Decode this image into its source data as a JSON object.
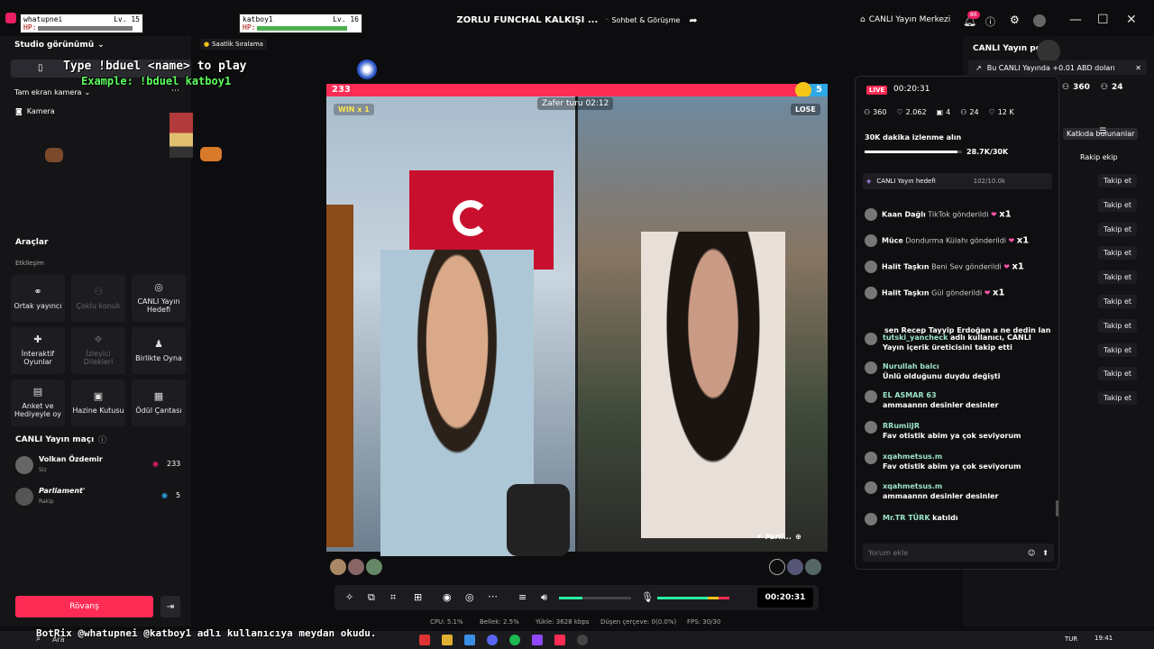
{
  "titlebar": {
    "stream_title": "ZORLU FUNCHAL KALKIŞI ...",
    "category": "Sohbet & Görüşme",
    "center_label": "CANLI Yayın Merkezi",
    "notif_count": "86"
  },
  "overlay": {
    "p1_name": "whatupnei",
    "p1_level": "Lv. 15",
    "p1_hp": "HP:",
    "p2_name": "katboy1",
    "p2_level": "Lv. 16",
    "p2_hp": "HP:",
    "cmd_line1": "Type !bduel <name> to play",
    "cmd_line2": "Example: !bduel katboy1",
    "botrix": "BotRix @whatupnei @katboy1 adlı kullanıcıya meydan okudu.",
    "hourly": "Saatlik Sıralama"
  },
  "sidebar": {
    "studio": "Studio görünümü",
    "screen": "Tam ekran kamera",
    "camera": "Kamera",
    "tools_title": "Araçlar",
    "interaction": "Etkileşim",
    "tiles": [
      {
        "label": "Ortak yayıncı",
        "icon": "link-icon",
        "dim": false
      },
      {
        "label": "Çoklu konuk",
        "icon": "users-icon",
        "dim": true
      },
      {
        "label": "CANLI Yayın Hedefi",
        "icon": "target-icon",
        "dim": false
      },
      {
        "label": "İnteraktif Oyunlar",
        "icon": "gamepad-icon",
        "dim": false
      },
      {
        "label": "İzleyici Dilekleri",
        "icon": "gift-icon",
        "dim": true
      },
      {
        "label": "Birlikte Oyna",
        "icon": "player-icon",
        "dim": false
      },
      {
        "label": "Anket ve Hediyeyle oy",
        "icon": "poll-icon",
        "dim": false
      },
      {
        "label": "Hazine Kutusu",
        "icon": "chest-icon",
        "dim": false
      },
      {
        "label": "Ödül Çantası",
        "icon": "bag-icon",
        "dim": false
      }
    ],
    "match_title": "CANLI Yayın maçı",
    "p1": {
      "name": "Volkan Özdemir",
      "role": "Siz",
      "score": "233"
    },
    "p2": {
      "name": "Parliament'",
      "role": "Rakip",
      "score": "5"
    },
    "rematch": "Rövanş"
  },
  "battle": {
    "score_left": "233",
    "score_right": "5",
    "win": "WIN x 1",
    "lose": "LOSE",
    "timer": "Zafer turu 02:12",
    "opponent_tag": "Parli..."
  },
  "controls": {
    "time": "00:20:31"
  },
  "stats": {
    "cpu": "CPU: 5.1%",
    "mem": "Bellek: 2.5%",
    "upload": "Yükle: 3628 kbps",
    "drop": "Düşen çerçeve: 0(0.0%)",
    "fps": "FPS: 30/30"
  },
  "chat": {
    "live": "LIVE",
    "time": "00:20:31",
    "viewers": "360",
    "likes": "2.062",
    "gifts": "4",
    "people": "24",
    "hearts": "12 K",
    "goal_title": "30K dakika izlenme alın",
    "goal_progress": "28.7K/30K",
    "goal_pct": 0.957,
    "goal_row": "CANLI Yayın hedefi",
    "goal_row_val": "102/10.0k",
    "gifts_rows": [
      {
        "user": "Kaan Dağlı",
        "text": "TikTok gönderildi",
        "x": "x1"
      },
      {
        "user": "Müce",
        "text": "Dondurma Külahı gönderildi",
        "x": "x1"
      },
      {
        "user": "Halit Taşkın",
        "text": "Beni Sev gönderildi",
        "x": "x1"
      },
      {
        "user": "Halit Taşkın",
        "text": "Gül gönderildi",
        "x": "x1"
      }
    ],
    "msgs": [
      {
        "user": "",
        "text": "sen Recep Tayyip Erdoğan a ne dedin lan"
      },
      {
        "user": "tutski_yancheck",
        "text": "adlı kullanıcı, CANLI Yayın içerik üreticisini takip etti"
      },
      {
        "user": "Nurullah balcı",
        "text": "Ünlü olduğunu duydu değişti"
      },
      {
        "user": "EL ASMAR 63",
        "text": "ammaannn desinler desinler"
      },
      {
        "user": "RRumiiJR",
        "text": "Fav otistik abim ya çok seviyorum"
      },
      {
        "user": "xqahmetsus.m",
        "text": "Fav otistik abim ya çok seviyorum"
      },
      {
        "user": "xqahmetsus.m",
        "text": "ammaannn desinler desinler"
      },
      {
        "user": "Mr.TR TÜRK",
        "text": "katıldı"
      }
    ],
    "input_placeholder": "Yorum ekle"
  },
  "right": {
    "header": "CANLI Yayın pe",
    "banner": "Bu CANLI Yayında +0.01 ABD doları",
    "viewers": "360",
    "people": "24",
    "tab1": "Katkıda bulunanlar",
    "tab2": "Rakip ekip",
    "follow": "Takip et"
  },
  "taskbar": {
    "search": "Ara",
    "lang": "TUR",
    "clock": "19:41"
  }
}
